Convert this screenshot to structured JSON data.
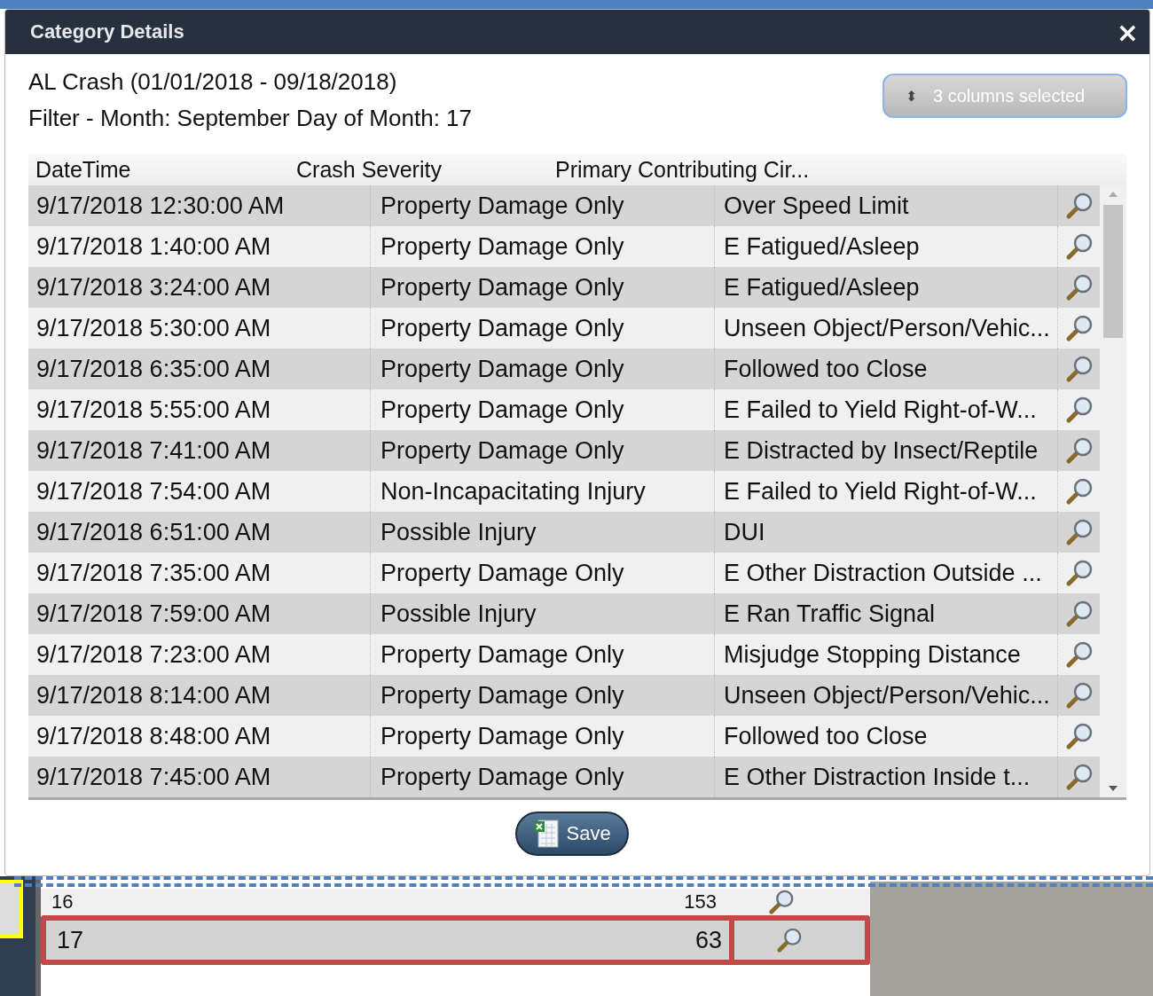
{
  "dialog": {
    "title": "Category Details",
    "close": "×"
  },
  "heading": "AL Crash (01/01/2018 - 09/18/2018)",
  "filter": "Filter - Month:  September Day of Month: 17",
  "column_picker": {
    "arrows": "⬍",
    "label": "3 columns selected"
  },
  "table": {
    "columns": [
      "DateTime",
      "Crash Severity",
      "Primary Contributing Cir..."
    ],
    "rows": [
      {
        "datetime": "9/17/2018 12:30:00 AM",
        "severity": "Property Damage Only",
        "cause": "Over Speed Limit"
      },
      {
        "datetime": "9/17/2018 1:40:00 AM",
        "severity": "Property Damage Only",
        "cause": "E Fatigued/Asleep"
      },
      {
        "datetime": "9/17/2018 3:24:00 AM",
        "severity": "Property Damage Only",
        "cause": "E Fatigued/Asleep"
      },
      {
        "datetime": "9/17/2018 5:30:00 AM",
        "severity": "Property Damage Only",
        "cause": "Unseen Object/Person/Vehic..."
      },
      {
        "datetime": "9/17/2018 6:35:00 AM",
        "severity": "Property Damage Only",
        "cause": "Followed too Close"
      },
      {
        "datetime": "9/17/2018 5:55:00 AM",
        "severity": "Property Damage Only",
        "cause": "E Failed to Yield Right-of-W..."
      },
      {
        "datetime": "9/17/2018 7:41:00 AM",
        "severity": "Property Damage Only",
        "cause": "E Distracted by Insect/Reptile"
      },
      {
        "datetime": "9/17/2018 7:54:00 AM",
        "severity": "Non-Incapacitating Injury",
        "cause": "E Failed to Yield Right-of-W..."
      },
      {
        "datetime": "9/17/2018 6:51:00 AM",
        "severity": "Possible Injury",
        "cause": "DUI"
      },
      {
        "datetime": "9/17/2018 7:35:00 AM",
        "severity": "Property Damage Only",
        "cause": "E Other Distraction Outside ..."
      },
      {
        "datetime": "9/17/2018 7:59:00 AM",
        "severity": "Possible Injury",
        "cause": "E Ran Traffic Signal"
      },
      {
        "datetime": "9/17/2018 7:23:00 AM",
        "severity": "Property Damage Only",
        "cause": "Misjudge Stopping Distance"
      },
      {
        "datetime": "9/17/2018 8:14:00 AM",
        "severity": "Property Damage Only",
        "cause": "Unseen Object/Person/Vehic..."
      },
      {
        "datetime": "9/17/2018 8:48:00 AM",
        "severity": "Property Damage Only",
        "cause": "Followed too Close"
      },
      {
        "datetime": "9/17/2018 7:45:00 AM",
        "severity": "Property Damage Only",
        "cause": "E Other Distraction Inside t..."
      }
    ]
  },
  "save_button": "Save",
  "background_table": {
    "rows": [
      {
        "day": "16",
        "count": "153",
        "selected": false
      },
      {
        "day": "17",
        "count": "63",
        "selected": true
      }
    ]
  }
}
